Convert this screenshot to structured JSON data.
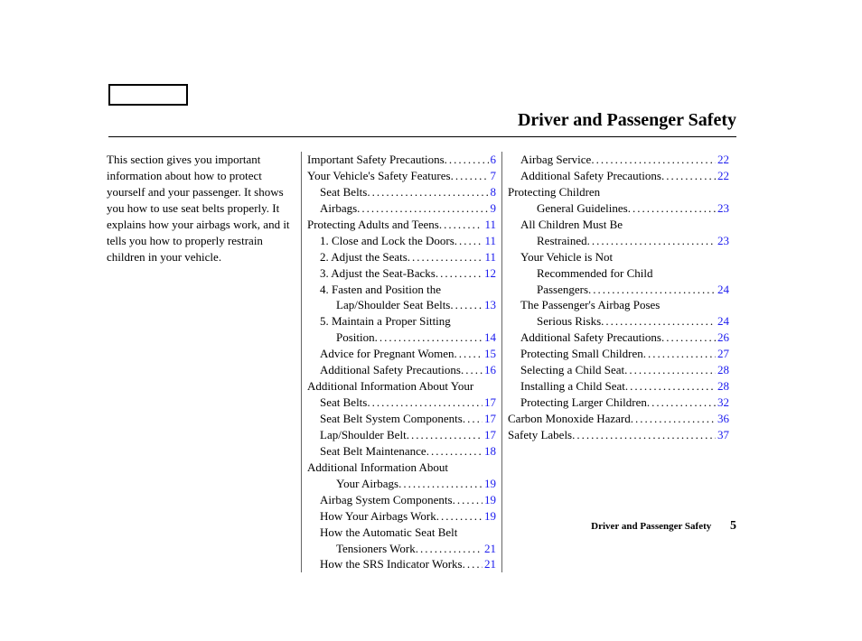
{
  "header": {
    "title": "Driver and Passenger Safety"
  },
  "intro": "This section gives you important information about how to protect yourself and your passenger. It shows you how to use seat belts properly. It explains how your airbags work, and it tells you how to properly restrain children in your vehicle.",
  "col1": [
    {
      "label": "Important Safety Precautions",
      "page": "6",
      "indent": 0
    },
    {
      "label": "Your Vehicle's Safety Features",
      "page": "7",
      "indent": 0
    },
    {
      "label": "Seat Belts",
      "page": "8",
      "indent": 1
    },
    {
      "label": "Airbags",
      "page": "9",
      "indent": 1
    },
    {
      "label": "Protecting Adults and Teens",
      "page": "11",
      "indent": 0
    },
    {
      "label": "1. Close and Lock the Doors",
      "page": "11",
      "indent": 1
    },
    {
      "label": "2. Adjust the Seats",
      "page": "11",
      "indent": 1
    },
    {
      "label": "3. Adjust the Seat-Backs",
      "page": "12",
      "indent": 1
    },
    {
      "label": "4. Fasten and Position the",
      "indent": 1,
      "nolead": true
    },
    {
      "label": "Lap/Shoulder Seat Belts",
      "page": "13",
      "indent": 2
    },
    {
      "label": "5. Maintain a Proper Sitting",
      "indent": 1,
      "nolead": true
    },
    {
      "label": "Position",
      "page": "14",
      "indent": 2
    },
    {
      "label": "Advice for Pregnant Women",
      "page": "15",
      "indent": 1
    },
    {
      "label": "Additional Safety Precautions",
      "page": "16",
      "indent": 1
    },
    {
      "label": "Additional Information About Your",
      "indent": 0,
      "nolead": true
    },
    {
      "label": "Seat Belts",
      "page": "17",
      "indent": 1
    },
    {
      "label": "Seat Belt System Components",
      "page": "17",
      "indent": 1
    },
    {
      "label": "Lap/Shoulder Belt",
      "page": "17",
      "indent": 1
    },
    {
      "label": "Seat Belt Maintenance",
      "page": "18",
      "indent": 1
    },
    {
      "label": "Additional Information About",
      "indent": 0,
      "nolead": true
    },
    {
      "label": "Your Airbags",
      "page": "19",
      "indent": 2
    },
    {
      "label": "Airbag System Components",
      "page": "19",
      "indent": 1
    },
    {
      "label": "How Your Airbags Work",
      "page": "19",
      "indent": 1
    },
    {
      "label": "How the Automatic Seat Belt",
      "indent": 1,
      "nolead": true
    },
    {
      "label": "Tensioners Work",
      "page": "21",
      "indent": 2
    },
    {
      "label": "How the SRS Indicator Works",
      "page": "21",
      "indent": 1
    }
  ],
  "col2": [
    {
      "label": "Airbag Service",
      "page": "22",
      "indent": 1
    },
    {
      "label": "Additional Safety Precautions",
      "page": "22",
      "indent": 1
    },
    {
      "label": "Protecting Children",
      "indent": 0,
      "nolead": true
    },
    {
      "label": "General Guidelines",
      "page": "23",
      "indent": 2
    },
    {
      "label": "All Children Must Be",
      "indent": 1,
      "nolead": true
    },
    {
      "label": "Restrained",
      "page": "23",
      "indent": 2
    },
    {
      "label": "Your Vehicle is Not",
      "indent": 1,
      "nolead": true
    },
    {
      "label": "Recommended for Child",
      "indent": 2,
      "nolead": true
    },
    {
      "label": "Passengers",
      "page": "24",
      "indent": 2
    },
    {
      "label": "The Passenger's Airbag Poses",
      "indent": 1,
      "nolead": true
    },
    {
      "label": "Serious Risks",
      "page": "24",
      "indent": 2
    },
    {
      "label": "Additional Safety Precautions",
      "page": "26",
      "indent": 1
    },
    {
      "label": "Protecting Small Children",
      "page": "27",
      "indent": 1
    },
    {
      "label": "Selecting a Child Seat",
      "page": "28",
      "indent": 1
    },
    {
      "label": "Installing a Child Seat",
      "page": "28",
      "indent": 1
    },
    {
      "label": "Protecting Larger Children",
      "page": "32",
      "indent": 1
    },
    {
      "label": "Carbon Monoxide Hazard",
      "page": "36",
      "indent": 0
    },
    {
      "label": "Safety Labels",
      "page": "37",
      "indent": 0
    }
  ],
  "footer": {
    "section": "Driver and Passenger Safety",
    "page": "5"
  }
}
